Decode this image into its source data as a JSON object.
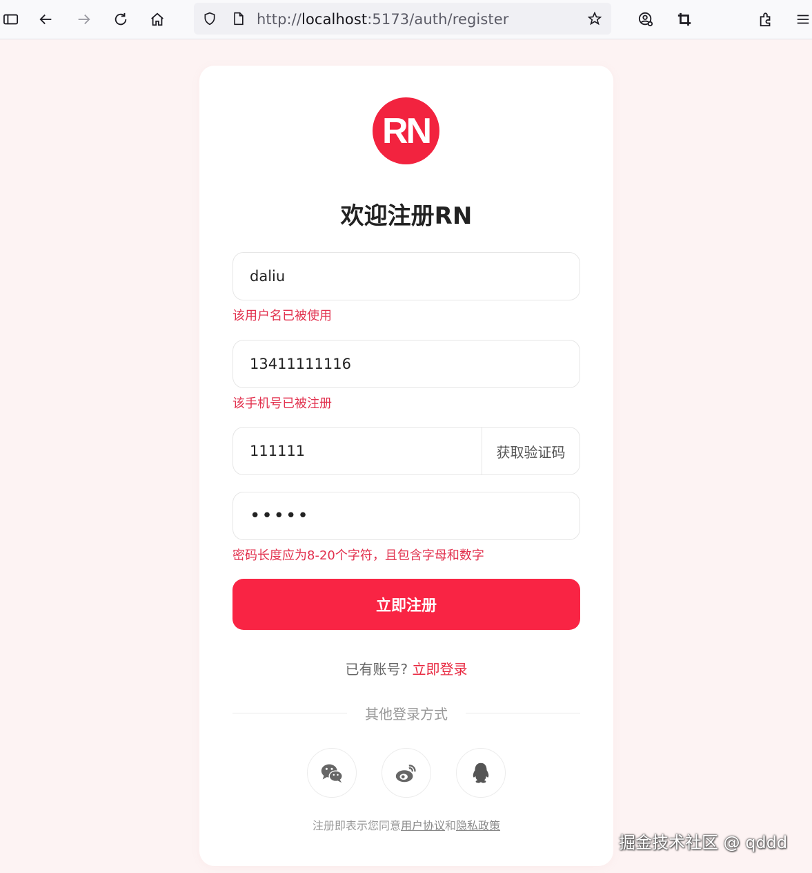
{
  "browser": {
    "url_scheme": "http://",
    "url_host": "localhost",
    "url_path": ":5173/auth/register",
    "icons": [
      "sidebar-icon",
      "back-icon",
      "forward-icon",
      "reload-icon",
      "home-icon",
      "shield-icon",
      "page-icon",
      "star-icon",
      "account-icon",
      "crop-icon",
      "extensions-icon",
      "menu-icon"
    ]
  },
  "card": {
    "logo_text": "RN",
    "title": "欢迎注册RN",
    "username": {
      "value": "daliu",
      "error": "该用户名已被使用"
    },
    "phone": {
      "value": "13411111116",
      "error": "该手机号已被注册"
    },
    "code": {
      "value": "111111",
      "button": "获取验证码"
    },
    "password": {
      "value": "12345",
      "error": "密码长度应为8-20个字符，且包含字母和数字"
    },
    "submit_label": "立即注册",
    "has_account": "已有账号?",
    "login_link": "立即登录",
    "other_login": "其他登录方式",
    "social_icons": [
      "wechat-icon",
      "weibo-icon",
      "qq-icon"
    ],
    "terms_prefix": "注册即表示您同意",
    "terms_user_agreement": "用户协议",
    "terms_and": "和",
    "terms_privacy": "隐私政策"
  },
  "colors": {
    "brand": "#f92444",
    "error": "#e2314e",
    "page_bg": "#fdf3f3"
  },
  "watermark": "掘金技术社区 @ qddd"
}
